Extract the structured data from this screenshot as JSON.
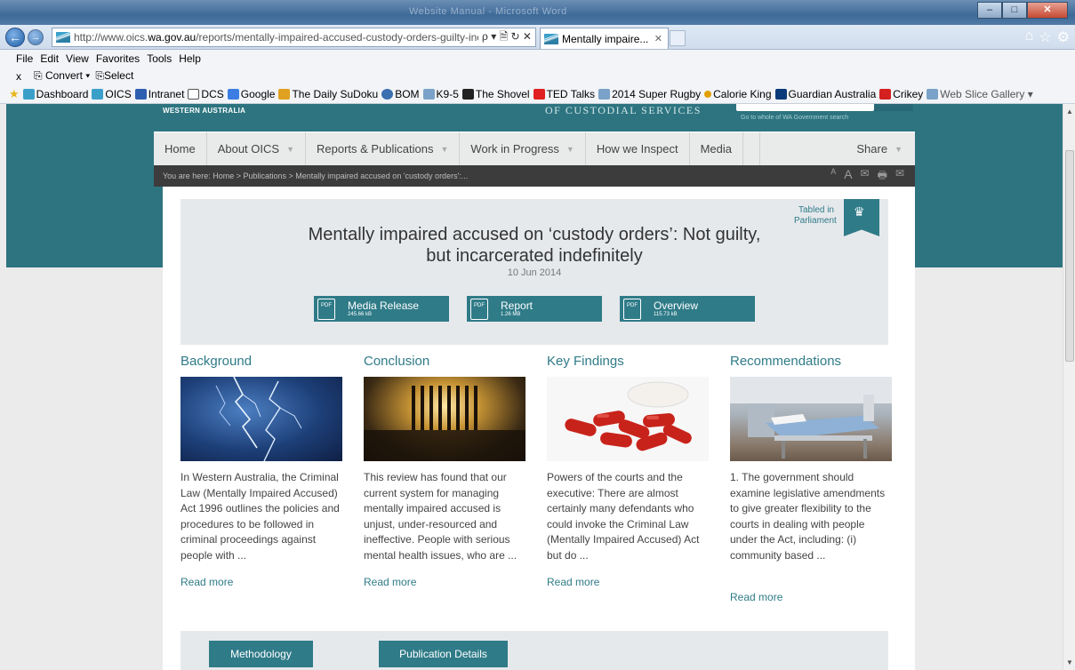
{
  "browser": {
    "title_blur": "Website Manual - Microsoft Word",
    "url_prefix": "http://www.oics.",
    "url_domain": "wa.gov.au",
    "url_path": "/reports/mentally-impaired-accused-custody-orders-guilty-inc",
    "addr_controls": "ρ ▾ 🗎 ↻ ✕",
    "tab_title": "Mentally impaire...",
    "menu": [
      "File",
      "Edit",
      "View",
      "Favorites",
      "Tools",
      "Help"
    ],
    "convert_label": "Convert",
    "select_label": "Select",
    "close_x": "x",
    "favorites": [
      {
        "label": "Dashboard",
        "color": "#3aa0c9"
      },
      {
        "label": "OICS",
        "color": "#3aa0c9"
      },
      {
        "label": "Intranet",
        "color": "#2f5fb0"
      },
      {
        "label": "DCS",
        "color": "#555555"
      },
      {
        "label": "Google",
        "color": "#3b7de3"
      },
      {
        "label": "The Daily SuDoku",
        "color": "#e0a020"
      },
      {
        "label": "BOM",
        "color": "#3a6fb0"
      },
      {
        "label": "K9-5",
        "color": "#7aa2c8"
      },
      {
        "label": "The Shovel",
        "color": "#222222"
      },
      {
        "label": "TED  Talks",
        "color": "#e02020"
      },
      {
        "label": "2014 Super Rugby",
        "color": "#7aa2c8"
      },
      {
        "label": "Calorie King",
        "color": "#e2a000"
      },
      {
        "label": "Guardian Australia",
        "color": "#0a3a7a"
      },
      {
        "label": "Crikey",
        "color": "#d52020"
      },
      {
        "label": "Web Slice Gallery ▾",
        "color": "#7aa2c8"
      }
    ]
  },
  "site": {
    "wa_label": "WESTERN AUSTRALIA",
    "org_label": "OF CUSTODIAL SERVICES",
    "gov_link": "Go to whole of WA Government search",
    "nav": [
      {
        "label": "Home",
        "caret": false
      },
      {
        "label": "About OICS",
        "caret": true
      },
      {
        "label": "Reports & Publications",
        "caret": true
      },
      {
        "label": "Work in Progress",
        "caret": true
      },
      {
        "label": "How we Inspect",
        "caret": false
      },
      {
        "label": "Media",
        "caret": false
      }
    ],
    "share_label": "Share",
    "breadcrumb": "You are here: Home > Publications > Mentally impaired accused on 'custody orders':...",
    "crumb_tools": [
      "A",
      "A",
      "✉",
      "🖶",
      "✉"
    ]
  },
  "report": {
    "tabled_label": "Tabled in Parliament",
    "title_line1": "Mentally impaired accused on ‘custody orders’: Not guilty,",
    "title_line2": "but incarcerated indefinitely",
    "date": "10 Jun 2014",
    "downloads": [
      {
        "label": "Media Release",
        "size": "245.66 kB"
      },
      {
        "label": "Report",
        "size": "1.26 MB"
      },
      {
        "label": "Overview",
        "size": "115.73 kB"
      }
    ],
    "pdf_icon_label": "PDF"
  },
  "sections": [
    {
      "heading": "Background",
      "image": "lightning-storm",
      "text": "In Western Australia, the Criminal Law (Mentally Impaired Accused) Act 1996 outlines the policies and procedures to be followed in criminal proceedings against people with ...",
      "link": "Read more"
    },
    {
      "heading": "Conclusion",
      "image": "prison-bars",
      "text": "This review has found that our current system for managing mentally impaired accused is unjust, under-resourced and ineffective. People with serious mental health issues, who are ...",
      "link": "Read more"
    },
    {
      "heading": "Key Findings",
      "image": "red-pills",
      "text": "Powers of the courts and the executive: There are almost certainly many defendants who could invoke the Criminal Law (Mentally Impaired Accused) Act but do ...",
      "link": "Read more"
    },
    {
      "heading": "Recommendations",
      "image": "hospital-bed",
      "text": "1. The government should examine legislative amendments to give greater flexibility to the courts in dealing with people under the Act, including: (i)  community based ...",
      "link": "Read more"
    }
  ],
  "footer_buttons": [
    "Methodology",
    "Publication Details"
  ]
}
